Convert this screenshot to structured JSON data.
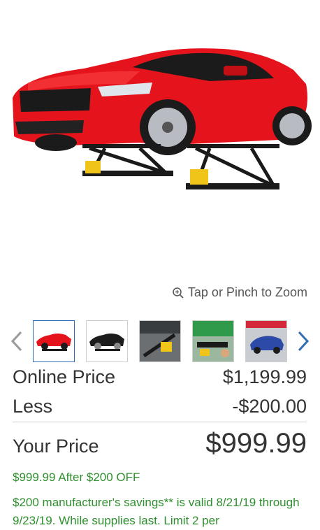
{
  "zoom_hint": "Tap or Pinch to Zoom",
  "thumbnails": [
    {
      "name": "thumbnail-red-car"
    },
    {
      "name": "thumbnail-black-car"
    },
    {
      "name": "thumbnail-lift-detail"
    },
    {
      "name": "thumbnail-lift-green"
    },
    {
      "name": "thumbnail-blue-car"
    }
  ],
  "price": {
    "online_label": "Online Price",
    "online_value": "$1,199.99",
    "less_label": "Less",
    "less_value": "-$200.00",
    "your_label": "Your Price",
    "your_value": "$999.99"
  },
  "promo": {
    "line1": "$999.99 After $200 OFF",
    "line2": "$200 manufacturer's savings** is valid 8/21/19 through 9/23/19. While supplies last. Limit 2 per"
  },
  "colors": {
    "car_red": "#e5141c",
    "promo_green": "#2e8f2e",
    "nav_blue": "#2f6db5",
    "lift_black": "#1a1a1a",
    "lift_yellow": "#f0c419"
  },
  "icons": {
    "zoom": "zoom-in-icon",
    "prev": "chevron-left-icon",
    "next": "chevron-right-icon"
  }
}
